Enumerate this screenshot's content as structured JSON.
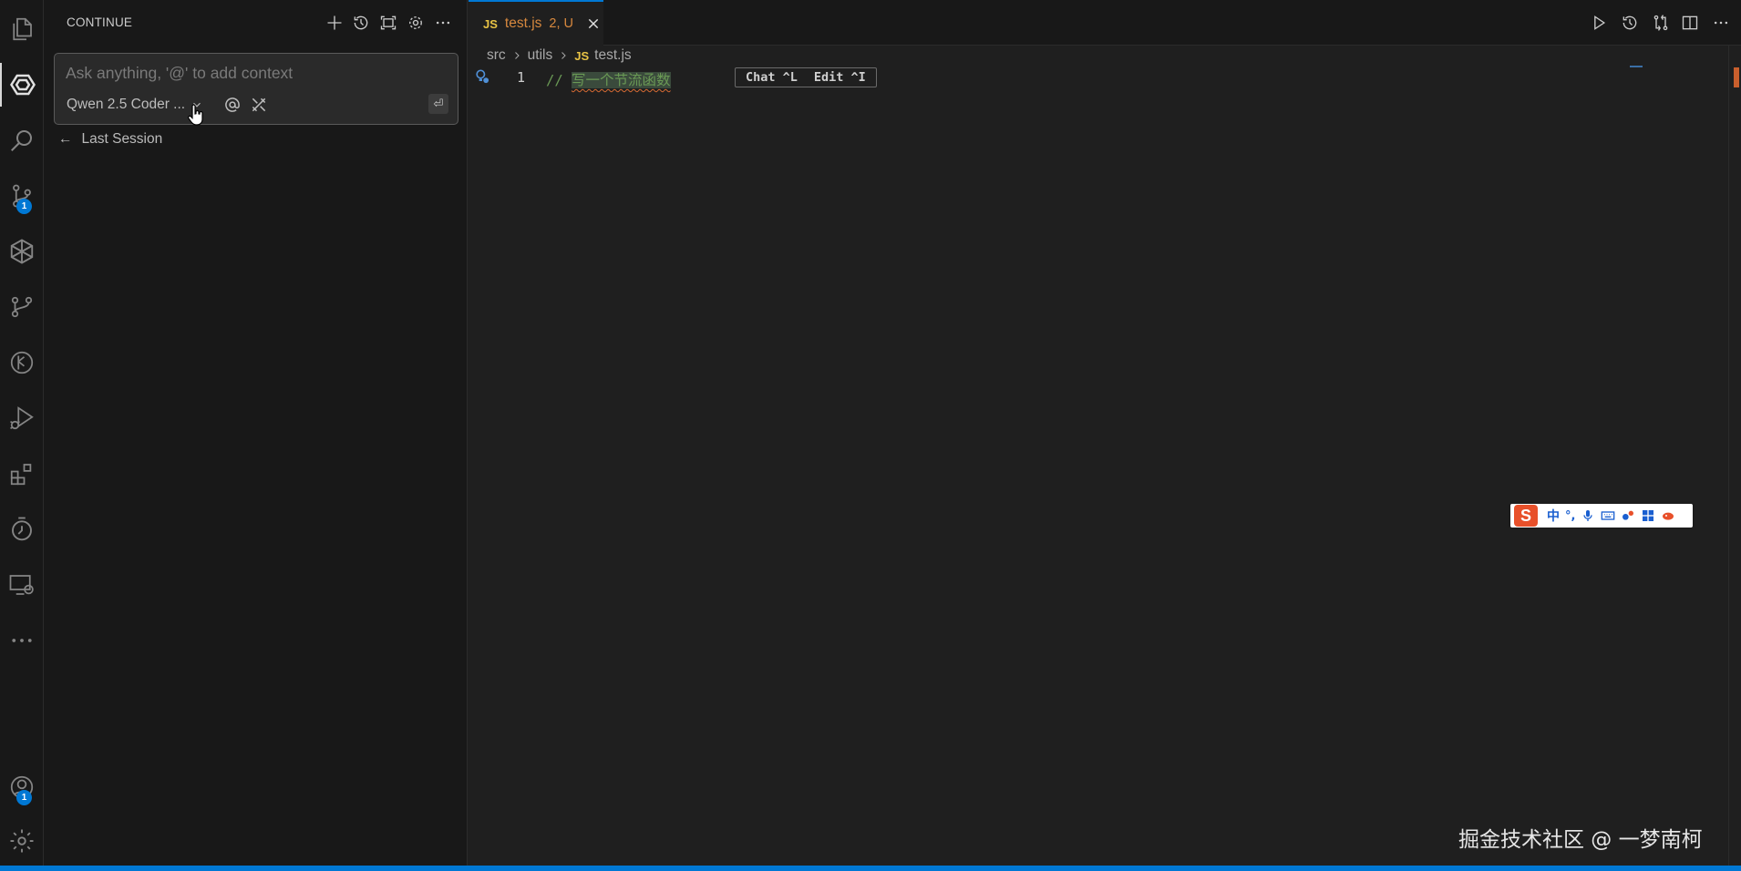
{
  "activity_bar": {
    "items": [
      {
        "name": "explorer",
        "badge": ""
      },
      {
        "name": "continue",
        "badge": ""
      },
      {
        "name": "search",
        "badge": ""
      },
      {
        "name": "source-control",
        "badge": "1"
      },
      {
        "name": "marscode",
        "badge": ""
      },
      {
        "name": "git-graph",
        "badge": ""
      },
      {
        "name": "gitlens",
        "badge": ""
      },
      {
        "name": "run-debug",
        "badge": ""
      },
      {
        "name": "extensions",
        "badge": ""
      },
      {
        "name": "timeline",
        "badge": ""
      },
      {
        "name": "remote-explorer",
        "badge": ""
      },
      {
        "name": "more",
        "badge": ""
      }
    ],
    "accounts_badge": "1"
  },
  "side_panel": {
    "title": "CONTINUE",
    "chat": {
      "placeholder": "Ask anything, '@' to add context",
      "value": "",
      "model": "Qwen 2.5 Coder ..."
    },
    "last_session": "Last Session"
  },
  "editor": {
    "tab": {
      "badge": "JS",
      "filename": "test.js",
      "status": "2, U"
    },
    "breadcrumb": [
      "src",
      "utils",
      "test.js"
    ],
    "breadcrumb_badge": "JS",
    "line_number": "1",
    "code_prefix": "// ",
    "code_comment": "写一个节流函数",
    "inline_hint": {
      "chat": "Chat ^L",
      "edit": "Edit ^I"
    }
  },
  "ime": {
    "logo": "S",
    "mode": "中",
    "punct": "°,"
  },
  "watermark": "掘金技术社区 @ 一梦南柯",
  "colors": {
    "accent": "#0078d4",
    "tab_modified": "#d7883e",
    "comment": "#6a9955",
    "js_badge": "#e8c345"
  }
}
